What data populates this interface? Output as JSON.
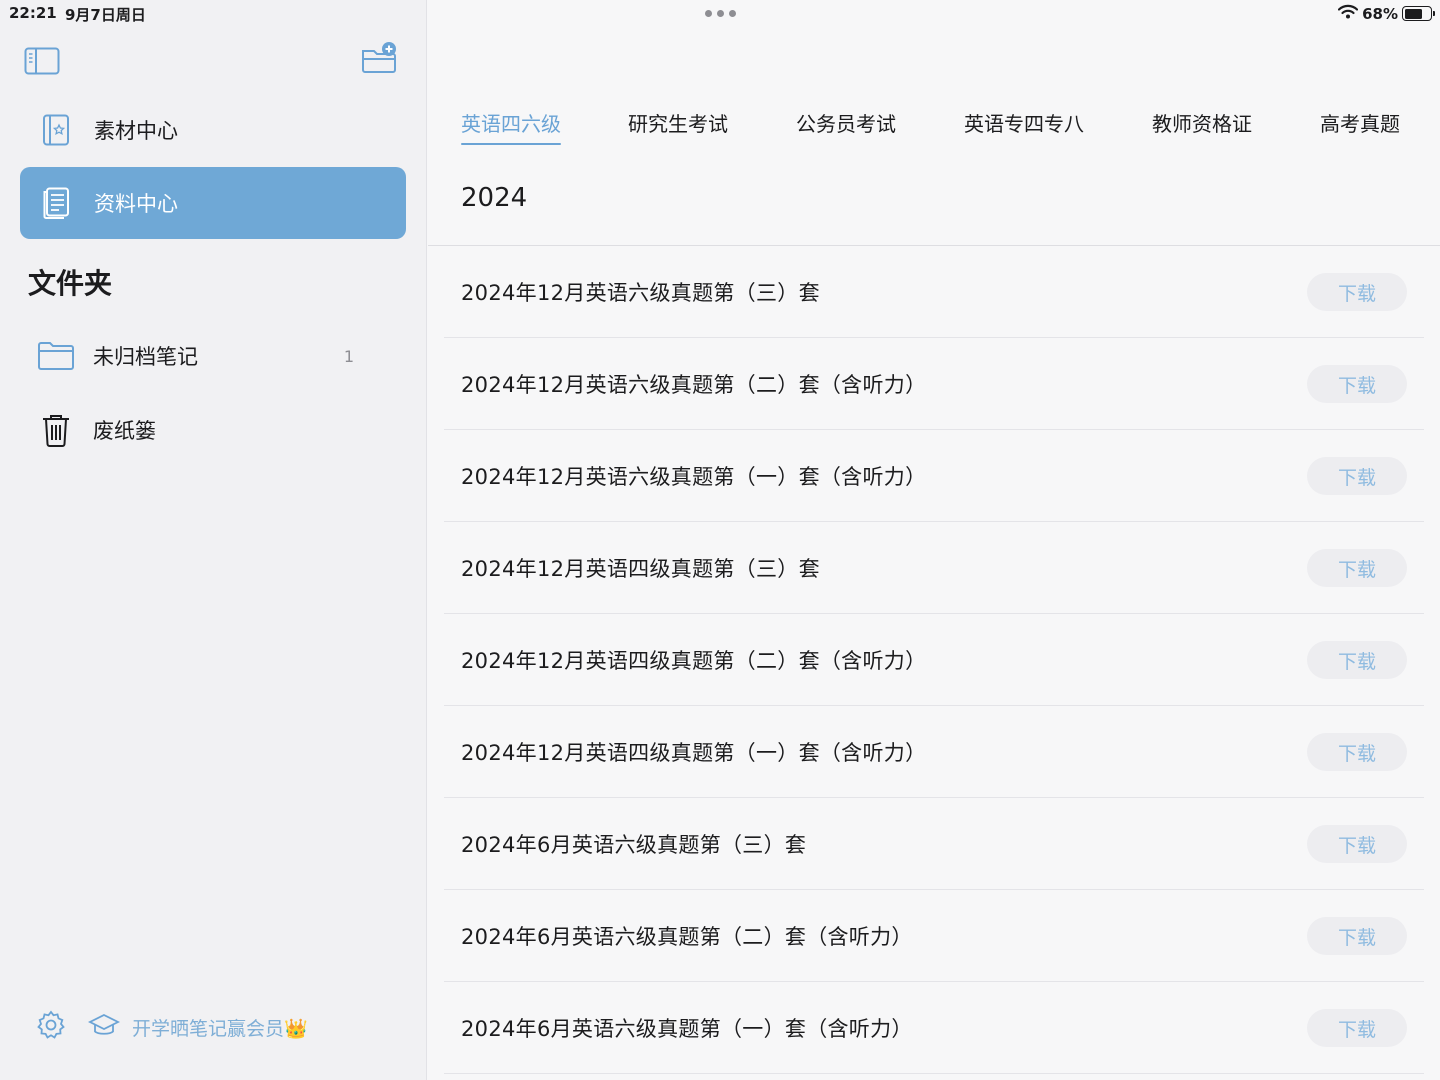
{
  "status_bar": {
    "time": "22:21",
    "date": "9月7日周日",
    "battery_text": "68%",
    "battery_level": 0.68
  },
  "sidebar": {
    "nav": [
      {
        "label": "素材中心",
        "icon": "material-book-icon",
        "active": false
      },
      {
        "label": "资料中心",
        "icon": "document-icon",
        "active": true
      }
    ],
    "folders_heading": "文件夹",
    "folders": [
      {
        "label": "未归档笔记",
        "count": "1",
        "icon": "folder-icon"
      },
      {
        "label": "废纸篓",
        "icon": "trash-icon"
      }
    ],
    "promo_text": "开学晒笔记赢会员👑"
  },
  "main": {
    "tabs": [
      {
        "label": "英语四六级",
        "active": true
      },
      {
        "label": "研究生考试",
        "active": false
      },
      {
        "label": "公务员考试",
        "active": false
      },
      {
        "label": "英语专四专八",
        "active": false
      },
      {
        "label": "教师资格证",
        "active": false
      },
      {
        "label": "高考真题",
        "active": false
      }
    ],
    "year": "2024",
    "download_label": "下载",
    "items": [
      {
        "title": "2024年12月英语六级真题第（三）套"
      },
      {
        "title": "2024年12月英语六级真题第（二）套（含听力）"
      },
      {
        "title": "2024年12月英语六级真题第（一）套（含听力）"
      },
      {
        "title": "2024年12月英语四级真题第（三）套"
      },
      {
        "title": "2024年12月英语四级真题第（二）套（含听力）"
      },
      {
        "title": "2024年12月英语四级真题第（一）套（含听力）"
      },
      {
        "title": "2024年6月英语六级真题第（三）套"
      },
      {
        "title": "2024年6月英语六级真题第（二）套（含听力）"
      },
      {
        "title": "2024年6月英语六级真题第（一）套（含听力）"
      }
    ]
  },
  "colors": {
    "accent": "#6fa8d6",
    "tab_active": "#6aa3d5",
    "download_text": "#8fbbe0"
  }
}
